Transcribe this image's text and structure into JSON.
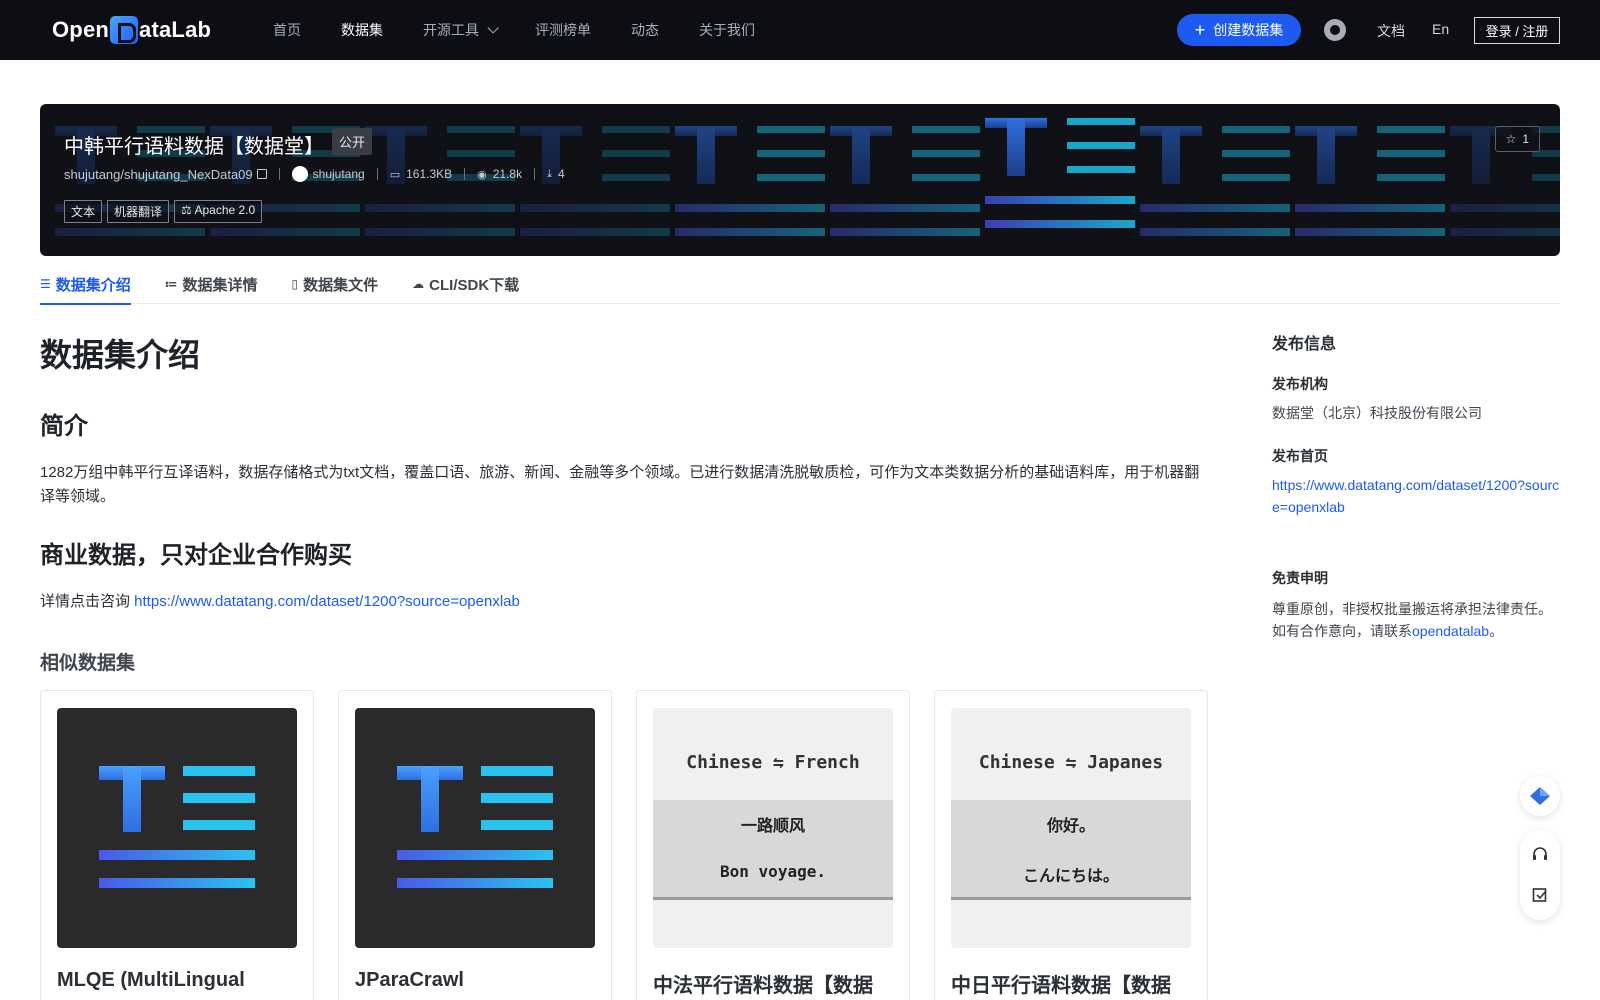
{
  "brand": {
    "logo_text_left": "Open",
    "logo_text_right": "ataLab"
  },
  "nav": {
    "items": [
      "首页",
      "数据集",
      "开源工具",
      "评测榜单",
      "动态",
      "关于我们"
    ],
    "create_label": "创建数据集",
    "docs_label": "文档",
    "lang_label": "En",
    "login_label": "登录 / 注册"
  },
  "dataset": {
    "title": "中韩平行语料数据【数据堂】",
    "visibility": "公开",
    "stars": "1",
    "path": "shujutang/shujutang_NexData09",
    "owner": "shujutang",
    "size": "161.3KB",
    "views": "21.8k",
    "downloads": "4",
    "tags": [
      "文本",
      "机器翻译"
    ],
    "license": "Apache 2.0"
  },
  "tabs": [
    {
      "label": "数据集介绍",
      "icon": "database-icon"
    },
    {
      "label": "数据集详情",
      "icon": "list-icon"
    },
    {
      "label": "数据集文件",
      "icon": "file-icon"
    },
    {
      "label": "CLI/SDK下载",
      "icon": "cloud-download-icon"
    }
  ],
  "content": {
    "heading": "数据集介绍",
    "intro_heading": "简介",
    "intro_text": "1282万组中韩平行互译语料，数据存储格式为txt文档，覆盖口语、旅游、新闻、金融等多个领域。已进行数据清洗脱敏质检，可作为文本类数据分析的基础语料库，用于机器翻译等领域。",
    "commercial_heading": "商业数据，只对企业合作购买",
    "detail_prefix": "详情点击咨询 ",
    "detail_link": "https://www.datatang.com/dataset/1200?source=openxlab",
    "similar_heading": "相似数据集"
  },
  "similar": [
    {
      "title": "MLQE (MultiLingual",
      "thumb": "te-logo"
    },
    {
      "title": "JParaCrawl",
      "thumb": "te-logo"
    },
    {
      "title": "中法平行语料数据【数据",
      "thumb": "translation",
      "top": "Chinese ⇋ French",
      "line1": "一路顺风",
      "line2": "Bon voyage."
    },
    {
      "title": "中日平行语料数据【数据",
      "thumb": "translation",
      "top": "Chinese ⇋ Japanes",
      "line1": "你好。",
      "line2": "こんにちは。"
    }
  ],
  "sidebar": {
    "heading": "发布信息",
    "org_label": "发布机构",
    "org_value": "数据堂（北京）科技股份有限公司",
    "home_label": "发布首页",
    "home_value": "https://www.datatang.com/dataset/1200?source=openxlab",
    "disclaimer_label": "免责申明",
    "disclaimer_line1": "尊重原创，非授权批量搬运将承担法律责任。",
    "disclaimer_line2_prefix": "如有合作意向，请联系",
    "disclaimer_link": "opendatalab",
    "disclaimer_suffix": "。"
  },
  "colors": {
    "accent": "#1d5bf0",
    "nav_bg": "#0c0e14",
    "banner_bg": "#0f1117"
  }
}
